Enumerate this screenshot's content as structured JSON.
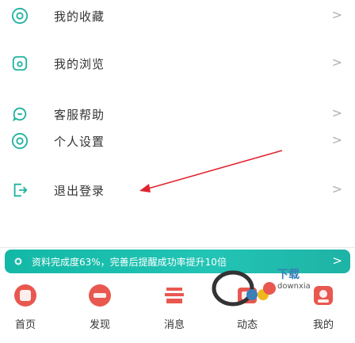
{
  "menu": {
    "items": [
      {
        "label": "我的收藏",
        "icon": "star-circle-icon"
      },
      {
        "label": "我的浏览",
        "icon": "history-icon"
      },
      {
        "label": "客服帮助",
        "icon": "chat-help-icon"
      },
      {
        "label": "个人设置",
        "icon": "settings-icon"
      },
      {
        "label": "退出登录",
        "icon": "logout-icon"
      }
    ],
    "chevron": ">"
  },
  "banner": {
    "text": "资料完成度63%，完善后提醒成功率提升10倍",
    "chevron": ">",
    "progress_percent": 63,
    "icon": "sparkle-icon"
  },
  "nav": {
    "items": [
      {
        "label": "首页",
        "icon": "home-icon",
        "color": "#e8584f"
      },
      {
        "label": "发现",
        "icon": "discover-icon",
        "color": "#e8584f"
      },
      {
        "label": "消息",
        "icon": "message-icon",
        "color": "#e8584f"
      },
      {
        "label": "动态",
        "icon": "feed-icon",
        "color": "#e8584f"
      },
      {
        "label": "我的",
        "icon": "profile-icon",
        "color": "#e8584f"
      }
    ]
  },
  "watermark": {
    "line1": "下载",
    "line2": "downxia"
  },
  "colors": {
    "accent": "#1eb8a8",
    "icon_stroke": "#20b2a0",
    "annotation": "#e0242f",
    "nav_accent": "#e8584f"
  }
}
